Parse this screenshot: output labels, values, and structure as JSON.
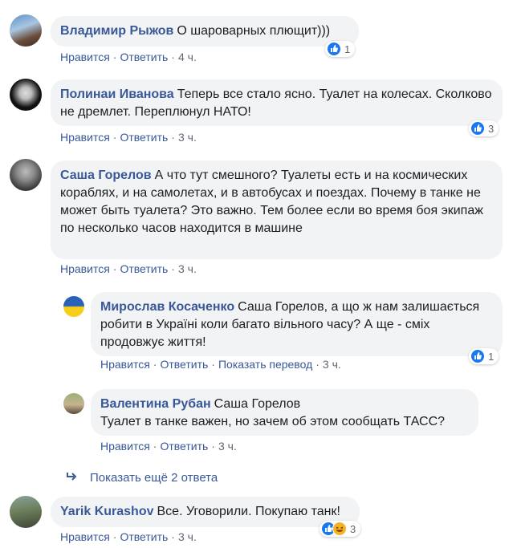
{
  "comments": [
    {
      "author": "Владимир Рыжов",
      "text": "О шароварных плющит)))",
      "likes": "Нравится",
      "reply": "Ответить",
      "time": "4 ч.",
      "reactions": "1"
    },
    {
      "author": "Полинаи Иванова",
      "text": "Теперь все стало ясно. Туалет на колесах. Сколково не дремлет. Переплюнул НАТО!",
      "likes": "Нравится",
      "reply": "Ответить",
      "time": "3 ч.",
      "reactions": "3"
    },
    {
      "author": "Саша Горелов",
      "text": "А что тут смешного? Туалеты есть и на космических кораблях, и на самолетах, и в автобусах и поездах. Почему в танке не может быть туалета? Это важно. Тем более если во время боя экипаж по несколько часов находится в машине",
      "likes": "Нравится",
      "reply": "Ответить",
      "time": "3 ч."
    },
    {
      "author": "Мирослав Косаченко",
      "text": "Саша Горелов, а що ж нам залишається робити в Україні коли багато вільного часу? А ще - сміх продовжує життя!",
      "likes": "Нравится",
      "reply": "Ответить",
      "translate": "Показать перевод",
      "time": "3 ч.",
      "reactions": "1"
    },
    {
      "author": "Валентина Рубан",
      "mention": "Саша Горелов",
      "text": "Туалет в танке важен, но зачем об этом сообщать ТАСС?",
      "likes": "Нравится",
      "reply": "Ответить",
      "time": "3 ч."
    },
    {
      "author": "Yarik Kurashov",
      "text": "Все. Уговорили. Покупаю танк!",
      "likes": "Нравится",
      "reply": "Ответить",
      "time": "3 ч.",
      "reactions": "3"
    }
  ],
  "more_replies": "Показать ещё 2 ответа",
  "colors": {
    "link": "#385898",
    "bubble": "#f2f3f5",
    "like": "#1877f2"
  }
}
